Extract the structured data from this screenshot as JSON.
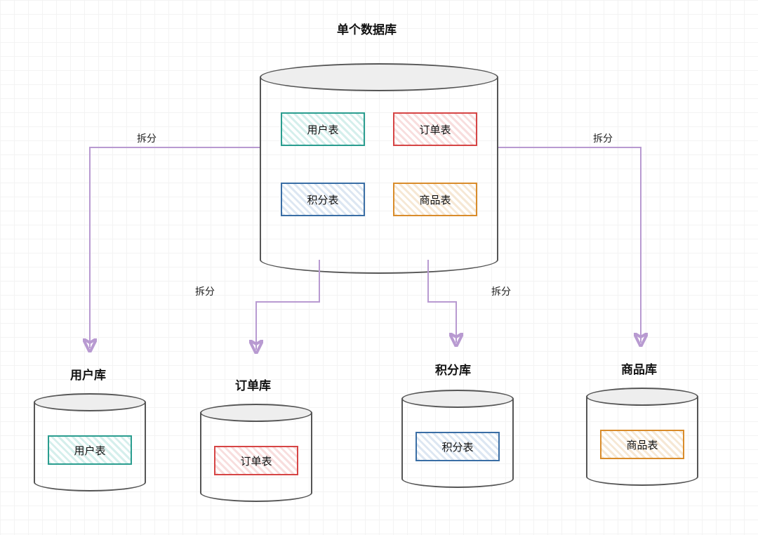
{
  "title": "单个数据库",
  "edge_labels": {
    "left": "拆分",
    "right": "拆分",
    "midL": "拆分",
    "midR": "拆分"
  },
  "big_db_tables": {
    "user": "用户表",
    "order": "订单表",
    "points": "积分表",
    "product": "商品表"
  },
  "small_dbs": [
    {
      "name": "用户库",
      "table_label": "用户表",
      "color": "teal"
    },
    {
      "name": "订单库",
      "table_label": "订单表",
      "color": "red"
    },
    {
      "name": "积分库",
      "table_label": "积分表",
      "color": "blue"
    },
    {
      "name": "商品库",
      "table_label": "商品表",
      "color": "orange"
    }
  ]
}
